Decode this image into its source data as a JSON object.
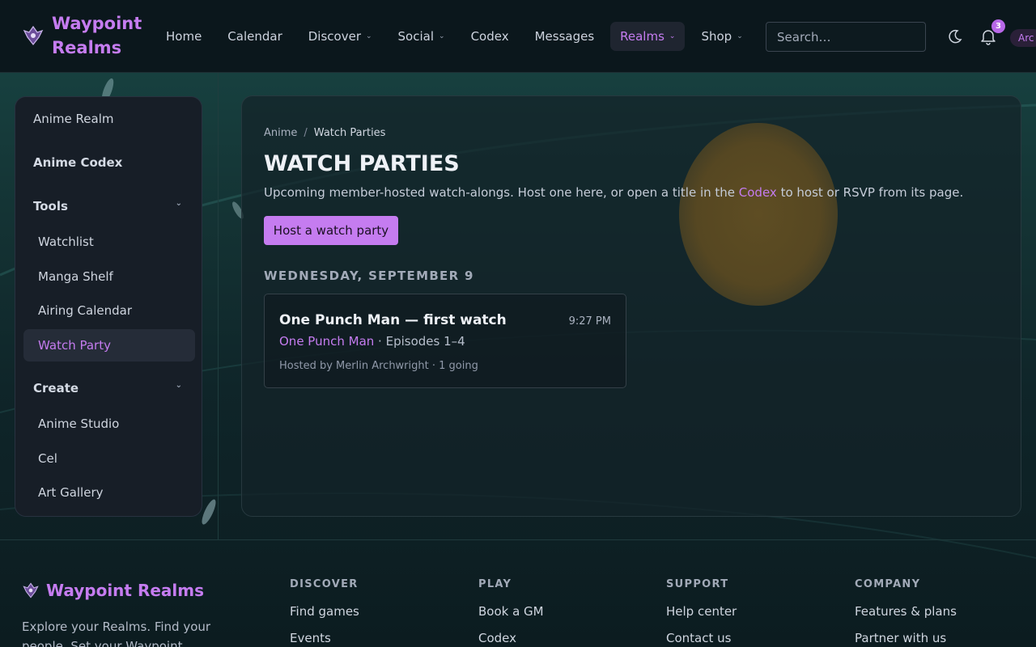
{
  "brand": {
    "name": "Waypoint Realms",
    "line1": "Waypoint",
    "line2": "Realms"
  },
  "nav": {
    "items": [
      {
        "label": "Home",
        "has_dropdown": false
      },
      {
        "label": "Calendar",
        "has_dropdown": false
      },
      {
        "label": "Discover",
        "has_dropdown": true
      },
      {
        "label": "Social",
        "has_dropdown": true
      },
      {
        "label": "Codex",
        "has_dropdown": false
      },
      {
        "label": "Messages",
        "has_dropdown": false
      },
      {
        "label": "Realms",
        "has_dropdown": true,
        "active": true
      },
      {
        "label": "Shop",
        "has_dropdown": true
      }
    ],
    "search_placeholder": "Search…",
    "notifications_count": "3",
    "user_label": "Arc"
  },
  "sidebar": {
    "realm_link": "Anime Realm",
    "codex_link": "Anime Codex",
    "tools": {
      "label": "Tools",
      "items": [
        "Watchlist",
        "Manga Shelf",
        "Airing Calendar",
        "Watch Party"
      ]
    },
    "create": {
      "label": "Create",
      "items": [
        "Anime Studio",
        "Cel",
        "Art Gallery"
      ]
    },
    "active_item": "Watch Party"
  },
  "main": {
    "breadcrumb": {
      "root": "Anime",
      "separator": "/",
      "current": "Watch Parties"
    },
    "title": "WATCH PARTIES",
    "intro_before": "Upcoming member-hosted watch-alongs. Host one here, or open a title in the ",
    "intro_link": "Codex",
    "intro_after": " to host or RSVP from its page.",
    "host_button": "Host a watch party",
    "day_label": "WEDNESDAY, SEPTEMBER 9",
    "party": {
      "title": "One Punch Man — first watch",
      "time": "9:27 PM",
      "show_link": "One Punch Man",
      "episodes": " · Episodes 1–4",
      "meta": "Hosted by Merlin Archwright · 1 going"
    }
  },
  "footer": {
    "brand": "Waypoint Realms",
    "blurb": "Explore your Realms. Find your people. Set your Waypoint.",
    "columns": [
      {
        "heading": "DISCOVER",
        "links": [
          "Find games",
          "Events"
        ]
      },
      {
        "heading": "PLAY",
        "links": [
          "Book a GM",
          "Codex"
        ]
      },
      {
        "heading": "SUPPORT",
        "links": [
          "Help center",
          "Contact us"
        ]
      },
      {
        "heading": "COMPANY",
        "links": [
          "Features & plans",
          "Partner with us"
        ]
      }
    ]
  },
  "colors": {
    "accent": "#c57cf0",
    "background": "#0d1d22",
    "panel": "#171e27"
  }
}
